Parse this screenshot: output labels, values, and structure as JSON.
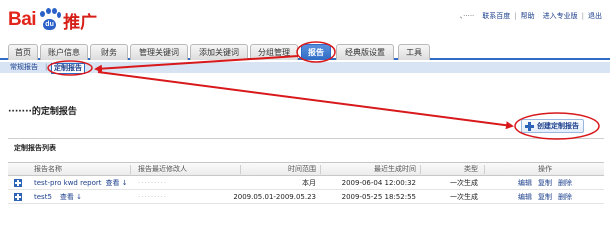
{
  "logo": {
    "text_bai": "Bai",
    "text_du": "du",
    "text_tui": "推广"
  },
  "toplinks": {
    "user": "、·····",
    "items": [
      "联系百度",
      "帮助",
      "进入专业版",
      "退出"
    ]
  },
  "tabs": [
    "首页",
    "账户信息",
    "财务",
    "管理关键词",
    "添加关键词",
    "分组管理",
    "报告",
    "经典版设置",
    "工具"
  ],
  "active_tab": "报告",
  "subtabs": {
    "normal": "常规报告",
    "separator": "|",
    "custom": "定制报告"
  },
  "page_title": "·······的定制报告",
  "create_button": "创建定制报告",
  "list_title": "定制报告列表",
  "table": {
    "headers": [
      "报告名称",
      "报告最近修改人",
      "时间范围",
      "最近生成时间",
      "类型",
      "操作"
    ],
    "rows": [
      {
        "name": "test-pro kwd report",
        "view": "查看",
        "modifier": "·········",
        "range": "本月",
        "generated": "2009-06-04 12:00:32",
        "type": "一次生成",
        "actions": [
          "编辑",
          "复制",
          "删除"
        ]
      },
      {
        "name": "test5",
        "view": "查看",
        "modifier": "·········",
        "range": "2009.05.01-2009.05.23",
        "generated": "2009-05-25 18:52:55",
        "type": "一次生成",
        "actions": [
          "编辑",
          "复制",
          "删除"
        ]
      }
    ]
  },
  "colors": {
    "brand_red": "#e1251b",
    "brand_blue": "#2e6cc6",
    "annotation_red": "#d8181a"
  }
}
